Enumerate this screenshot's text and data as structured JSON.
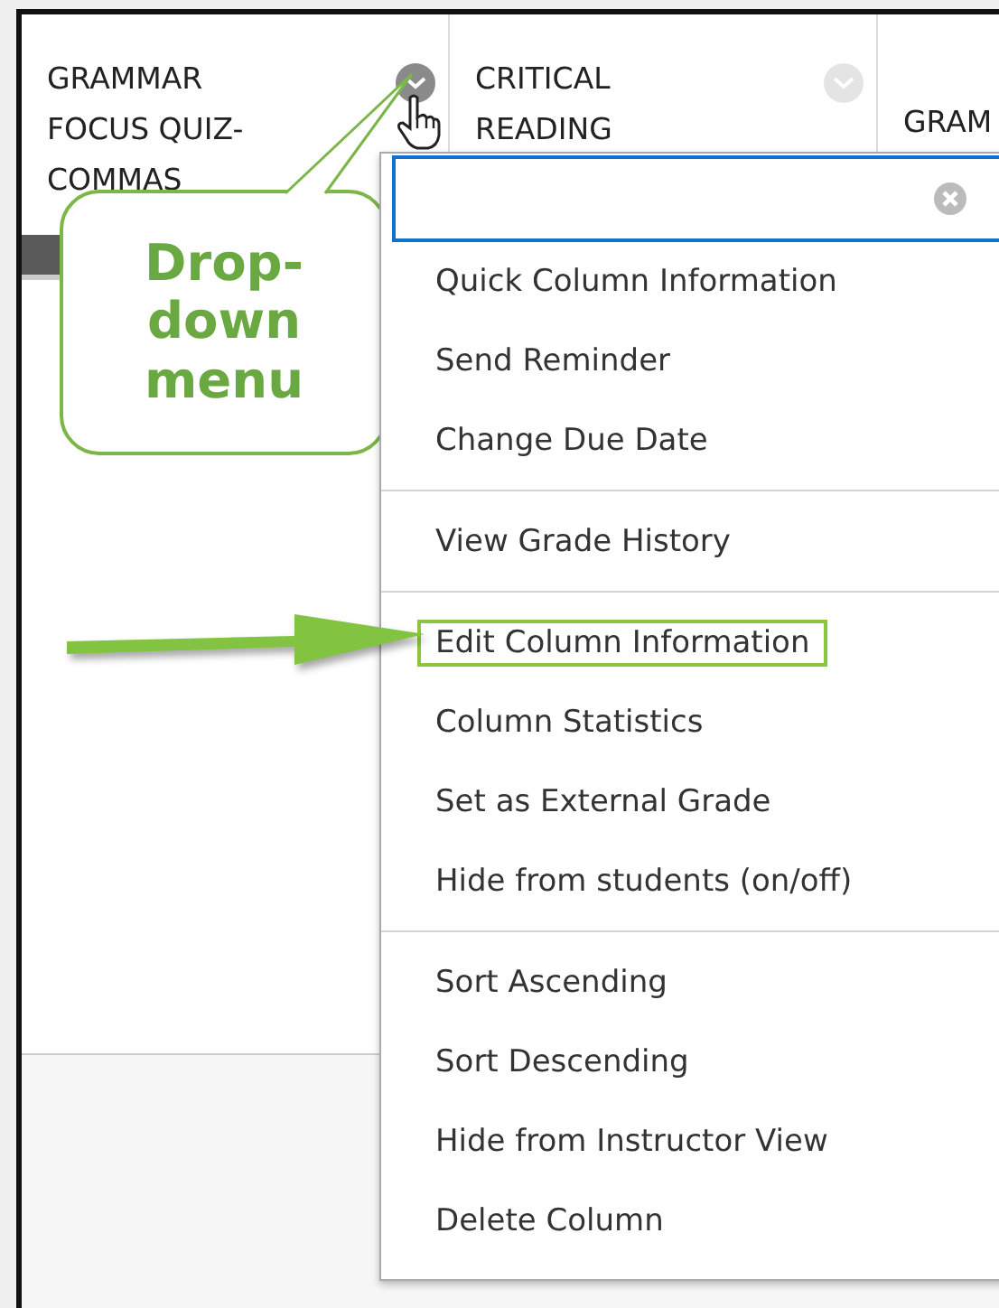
{
  "columns": [
    {
      "title_lines": [
        "GRAMMAR",
        "FOCUS QUIZ-",
        "COMMAS"
      ],
      "menu_button": {
        "selected": true
      }
    },
    {
      "title_lines": [
        "CRITICAL",
        "READING"
      ],
      "menu_button": {
        "selected": false
      }
    },
    {
      "title_lines": [
        "GRAM"
      ]
    }
  ],
  "menu": {
    "sections": [
      {
        "items": [
          {
            "label": "Quick Column Information",
            "highlighted": false
          },
          {
            "label": "Send Reminder",
            "highlighted": false
          },
          {
            "label": "Change Due Date",
            "highlighted": false
          }
        ]
      },
      {
        "items": [
          {
            "label": "View Grade History",
            "highlighted": false
          }
        ]
      },
      {
        "items": [
          {
            "label": "Edit Column Information",
            "highlighted": true
          },
          {
            "label": "Column Statistics",
            "highlighted": false
          },
          {
            "label": "Set as External Grade",
            "highlighted": false
          },
          {
            "label": "Hide from students (on/off)",
            "highlighted": false
          }
        ]
      },
      {
        "items": [
          {
            "label": "Sort Ascending",
            "highlighted": false
          },
          {
            "label": "Sort Descending",
            "highlighted": false
          },
          {
            "label": "Hide from Instructor View",
            "highlighted": false
          },
          {
            "label": "Delete Column",
            "highlighted": false
          }
        ]
      }
    ]
  },
  "callout": {
    "text": "Drop-down menu"
  }
}
